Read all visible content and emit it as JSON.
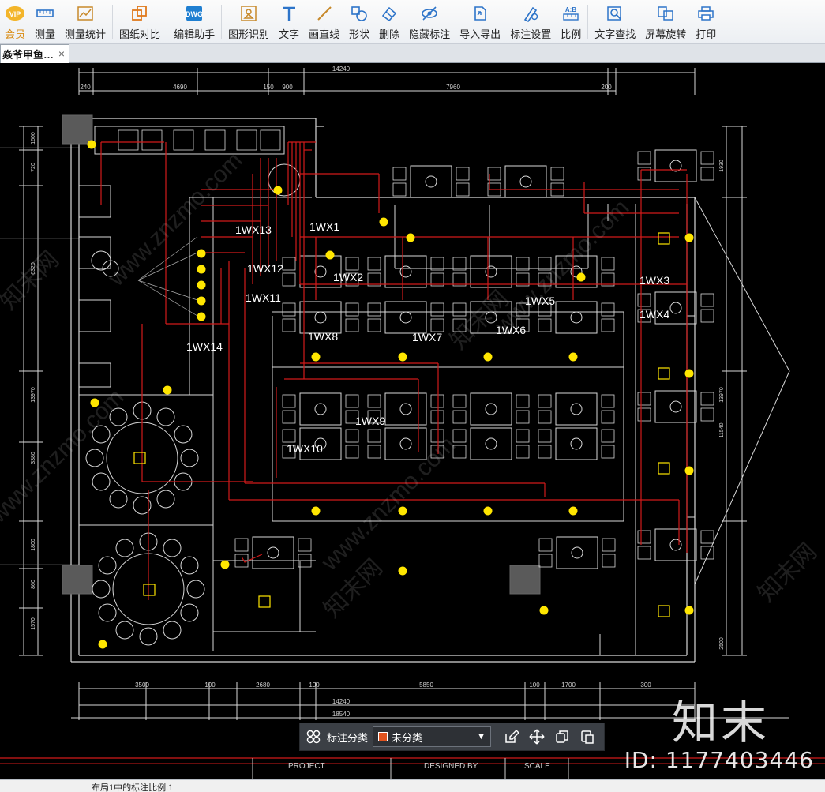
{
  "toolbar": {
    "items": [
      {
        "label": "会员",
        "icon": "vip-icon"
      },
      {
        "label": "测量",
        "icon": "ruler-icon"
      },
      {
        "label": "测量统计",
        "icon": "chart-icon"
      },
      {
        "label": "图纸对比",
        "icon": "compare-icon"
      },
      {
        "label": "编辑助手",
        "icon": "edit-assistant-icon"
      },
      {
        "label": "图形识别",
        "icon": "shape-recognize-icon"
      },
      {
        "label": "文字",
        "icon": "text-icon"
      },
      {
        "label": "画直线",
        "icon": "line-icon"
      },
      {
        "label": "形状",
        "icon": "shapes-icon"
      },
      {
        "label": "删除",
        "icon": "eraser-icon"
      },
      {
        "label": "隐藏标注",
        "icon": "eye-hide-icon"
      },
      {
        "label": "导入导出",
        "icon": "import-export-icon"
      },
      {
        "label": "标注设置",
        "icon": "settings-icon"
      },
      {
        "label": "比例",
        "icon": "scale-icon"
      },
      {
        "label": "文字查找",
        "icon": "find-text-icon"
      },
      {
        "label": "屏幕旋转",
        "icon": "rotate-icon"
      },
      {
        "label": "打印",
        "icon": "print-icon"
      }
    ]
  },
  "tab": {
    "title": "焱爷甲鱼…",
    "close": "×"
  },
  "drawing": {
    "circuit_labels": [
      "1WX1",
      "1WX2",
      "1WX3",
      "1WX4",
      "1WX5",
      "1WX6",
      "1WX7",
      "1WX8",
      "1WX9",
      "1WX10",
      "1WX11",
      "1WX12",
      "1WX13",
      "1WX14"
    ],
    "dims_top": [
      "14240",
      "240",
      "4690",
      "150",
      "900",
      "7960",
      "200"
    ],
    "dims_bottom": [
      "3500",
      "100",
      "2680",
      "100",
      "5850",
      "100",
      "1700",
      "300",
      "14240",
      "18540"
    ],
    "dims_left": [
      "1600",
      "720",
      "6320",
      "13970",
      "3380",
      "1800",
      "860",
      "1570"
    ],
    "dims_right": [
      "1930",
      "13970",
      "11540",
      "2500"
    ],
    "title_block": [
      "PROJECT",
      "DESIGNED BY",
      "SCALE"
    ]
  },
  "annotation_bar": {
    "label": "标注分类",
    "selected": "未分类",
    "swatch_color": "#e0531f"
  },
  "watermark": {
    "brand": "知末",
    "id": "ID: 1177403446",
    "site": "www.znzmo.com",
    "cn": "知末网"
  },
  "status": {
    "text": "布局1中的标注比例:1"
  }
}
